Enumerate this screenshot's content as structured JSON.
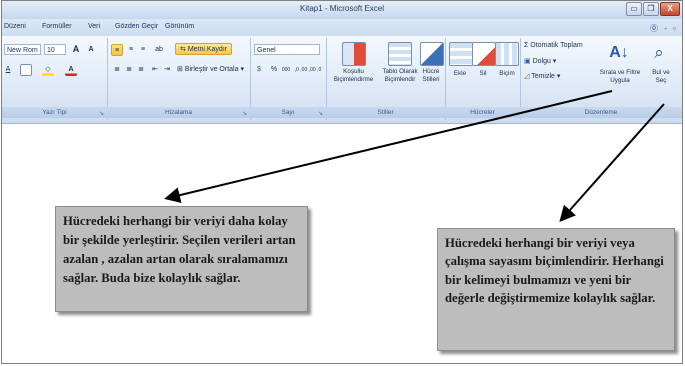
{
  "window": {
    "title": "Kitap1 - Microsoft Excel",
    "buttons": [
      "▭",
      "❐",
      "X"
    ]
  },
  "tabs": [
    "Düzeni",
    "Formüller",
    "Veri",
    "Gözden Geçir",
    "Görünüm"
  ],
  "ribbon_controls": {
    "help": "⓪",
    "min": "-",
    "restore": "▫"
  },
  "groups": {
    "font": {
      "label": "Yazı Tipi",
      "font_name": "New Rom",
      "font_size": "10",
      "grow": "A",
      "shrink": "A",
      "underline": "A",
      "font_color": "A"
    },
    "alignment": {
      "label": "Hizalama",
      "wrap_text": "Metni Kaydır",
      "merge_center": "Birleştir ve Ortala"
    },
    "number": {
      "label": "Sayı",
      "format": "Genel",
      "percent": "%",
      "comma": "000",
      "dec_inc": ",0 ,00",
      "dec_dec": ",00 ,0"
    },
    "styles": {
      "label": "Stiller",
      "conditional": [
        "Koşullu",
        "Biçimlendirme"
      ],
      "table": [
        "Tablo Olarak",
        "Biçimlendir"
      ],
      "cell": [
        "Hücre",
        "Stilleri"
      ]
    },
    "cells": {
      "label": "Hücreler",
      "insert": "Ekle",
      "delete": "Sil",
      "format": "Biçim"
    },
    "editing": {
      "label": "Düzenleme",
      "autosum": "Σ Otomatik Toplam",
      "fill": "Dolgu",
      "clear": "Temizle",
      "sort": [
        "Sırala ve Filtre",
        "Uygula"
      ],
      "find": [
        "Bul ve",
        "Seç"
      ]
    }
  },
  "callouts": {
    "left": "Hücredeki herhangi bir veriyi daha kolay bir şekilde yerleştirir. Seçilen verileri artan azalan , azalan artan olarak sıralamamızı sağlar. Buda bize kolaylık sağlar.",
    "right": "Hücredeki herhangi bir veriyi veya çalışma sayasını biçimlendirir. Herhangi bir kelimeyi bulmamızı ve yeni bir değerle değiştirmemize kolaylık sağlar."
  },
  "colors": {
    "ribbon_top": "#f4f8fd",
    "ribbon_bottom": "#cddcf0",
    "group_label": "#3b5b8c",
    "callout_bg": "#bdbdbd",
    "arrow": "#000000"
  }
}
